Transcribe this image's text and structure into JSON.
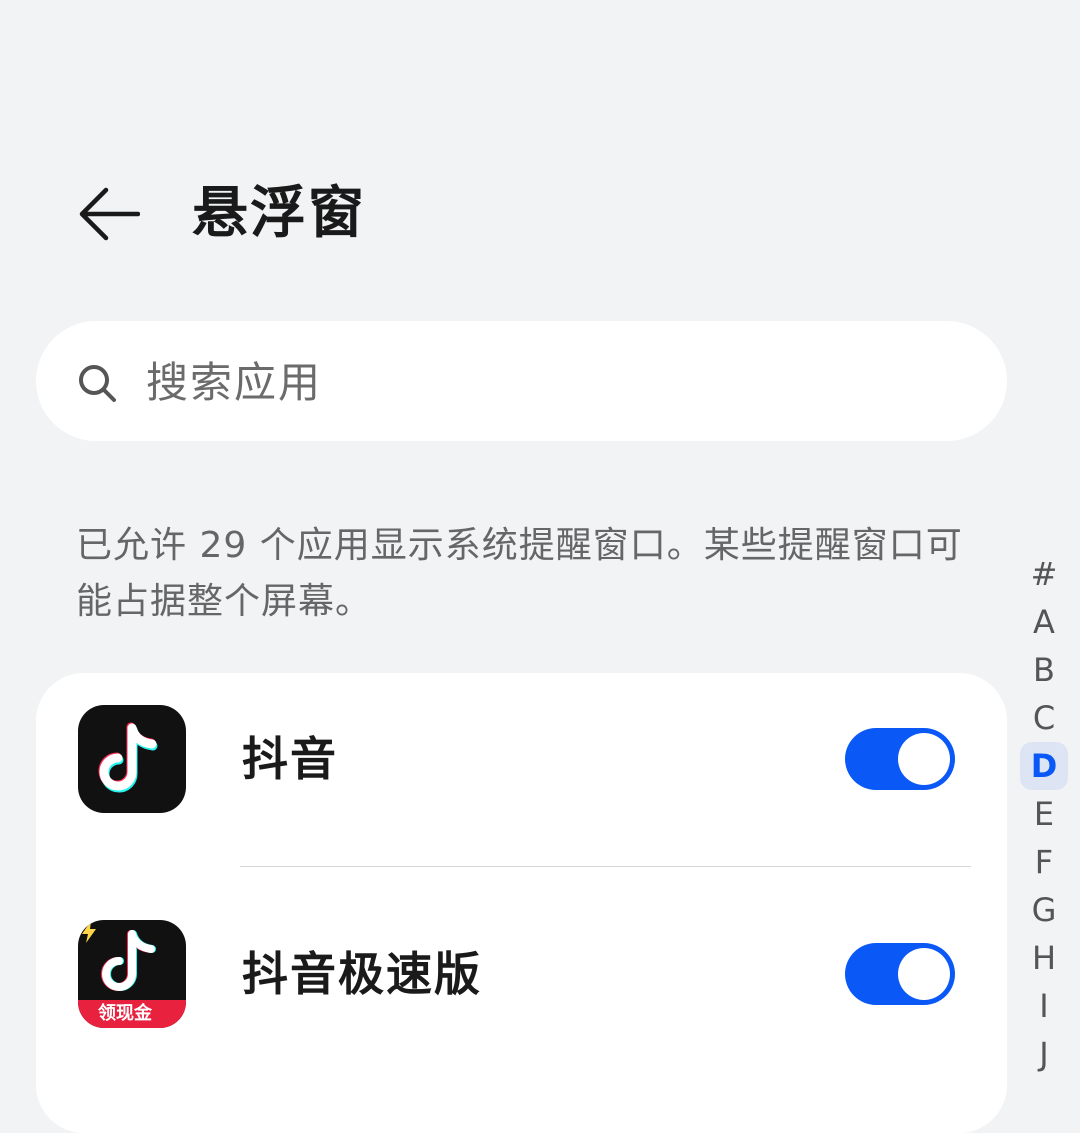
{
  "header": {
    "title": "悬浮窗",
    "back_icon": "arrow-left-icon"
  },
  "search": {
    "placeholder": "搜索应用",
    "icon": "search-icon"
  },
  "description": "已允许 29 个应用显示系统提醒窗口。某些提醒窗口可能占据整个屏幕。",
  "apps": [
    {
      "name": "抖音",
      "enabled": true,
      "icon": "douyin-app-icon"
    },
    {
      "name": "抖音极速版",
      "enabled": true,
      "icon": "douyin-lite-app-icon",
      "badge": "领现金"
    }
  ],
  "alpha_index": {
    "letters": [
      "#",
      "A",
      "B",
      "C",
      "D",
      "E",
      "F",
      "G",
      "H",
      "I",
      "J"
    ],
    "active": "D"
  },
  "colors": {
    "background": "#f1f3f5",
    "accent": "#0a59f7",
    "card": "#ffffff",
    "badge": "#e8213f"
  }
}
